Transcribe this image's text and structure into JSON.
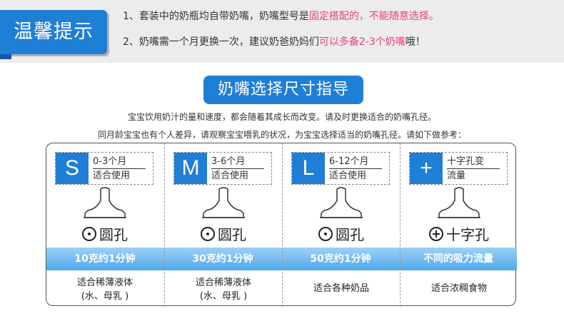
{
  "tips": {
    "label": "温馨提示",
    "line1": {
      "prefix": "1、套装中的奶瓶均自带奶嘴，奶嘴型号是",
      "highlight": "固定搭配的，不能随意选择。",
      "suffix": ""
    },
    "line2": {
      "prefix": "2、奶嘴需一个月更换一次，建议奶爸奶妈们",
      "highlight": "可以多备2-3个奶嘴",
      "suffix": "哦！"
    }
  },
  "guide": {
    "title": "奶嘴选择尺寸指导",
    "desc1": "宝宝饮用奶汁的量和速度，都会随着其成长而改变。请及时更换适合的奶嘴孔径。",
    "desc2": "同月龄宝宝也有个人差异，请观察宝宝喂乳的状况，为宝宝选择适当的奶嘴孔径。请如下做参考："
  },
  "colors": {
    "accent": "#1f7fd6",
    "highlight": "#e8417c",
    "band": "#4fa9ec"
  },
  "sizes": [
    {
      "letter": "S",
      "line1": "0-3个月",
      "line2": "适合使用",
      "hole_icon": "dot-hole-icon",
      "hole": "圆孔",
      "flow": "10克约1分钟",
      "use1": "适合稀薄液体",
      "use2": "(水、母乳 )"
    },
    {
      "letter": "M",
      "line1": "3-6个月",
      "line2": "适合使用",
      "hole_icon": "dot-hole-icon",
      "hole": "圆孔",
      "flow": "30克约1分钟",
      "use1": "适合稀薄液体",
      "use2": "(水、母乳 )"
    },
    {
      "letter": "L",
      "line1": "6-12个月",
      "line2": "适合使用",
      "hole_icon": "dot-hole-icon",
      "hole": "圆孔",
      "flow": "50克约1分钟",
      "use1": "适合各种奶品",
      "use2": ""
    },
    {
      "letter": "+",
      "line1": "十字孔变",
      "line2": "流量",
      "hole_icon": "cross-hole-icon",
      "hole": "十字孔",
      "flow": "不同的吸力流量",
      "use1": "适合浓稠食物",
      "use2": ""
    }
  ]
}
